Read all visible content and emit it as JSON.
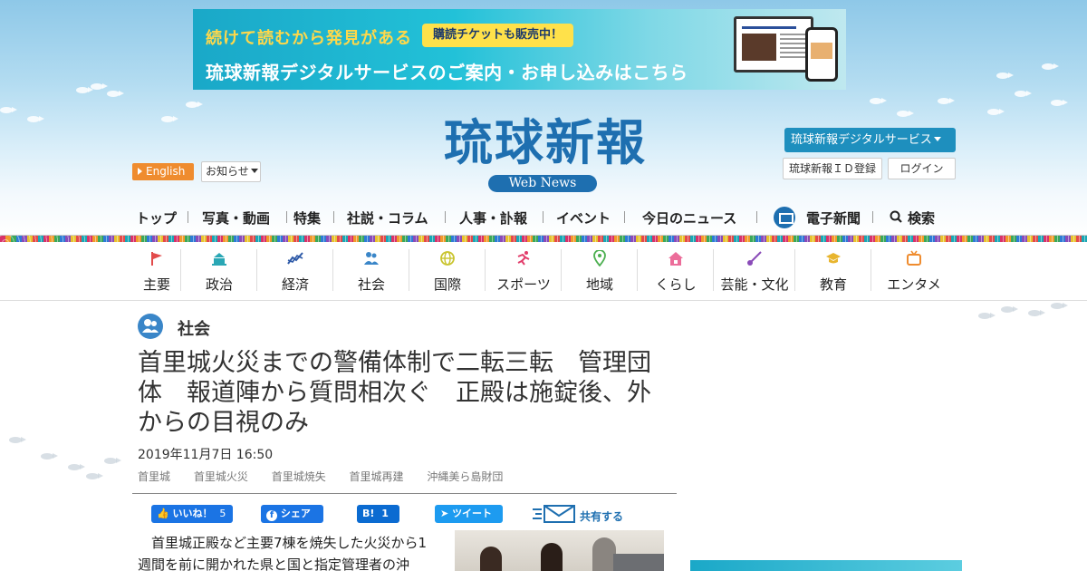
{
  "banner": {
    "line1": "続けて読むから発見がある",
    "pill": "購読チケットも販売中！",
    "line2": "琉球新報デジタルサービスのご案内・お申し込みはこちら"
  },
  "logo": {
    "title": "琉球新報",
    "subtitle": "Web News"
  },
  "header": {
    "english_label": "English",
    "notice_label": "お知らせ",
    "digital_service_label": "琉球新報デジタルサービス",
    "id_register_label": "琉球新報ＩＤ登録",
    "login_label": "ログイン"
  },
  "main_nav": {
    "items": [
      "トップ",
      "写真・動画",
      "特集",
      "社説・コラム",
      "人事・訃報",
      "イベント",
      "今日のニュース"
    ],
    "epaper_label": "電子新聞",
    "search_label": "検索"
  },
  "category_nav": {
    "items": [
      {
        "label": "主要",
        "icon": "flag-icon",
        "color": "#e24b4b"
      },
      {
        "label": "政治",
        "icon": "capitol-icon",
        "color": "#2aa7b5"
      },
      {
        "label": "経済",
        "icon": "chart-line-icon",
        "color": "#2e5aa8"
      },
      {
        "label": "社会",
        "icon": "people-icon",
        "color": "#3a86c8"
      },
      {
        "label": "国際",
        "icon": "globe-icon",
        "color": "#c9c42e"
      },
      {
        "label": "スポーツ",
        "icon": "runner-icon",
        "color": "#e23c6a"
      },
      {
        "label": "地域",
        "icon": "map-pin-icon",
        "color": "#4caf50"
      },
      {
        "label": "くらし",
        "icon": "house-icon",
        "color": "#ec6d9a"
      },
      {
        "label": "芸能・文化",
        "icon": "sanshin-icon",
        "color": "#8a4bb8"
      },
      {
        "label": "教育",
        "icon": "graduation-cap-icon",
        "color": "#e8b52e"
      },
      {
        "label": "エンタメ",
        "icon": "tv-icon",
        "color": "#ef8c2f"
      }
    ]
  },
  "article": {
    "section_label": "社会",
    "headline": "首里城火災までの警備体制で二転三転　管理団体　報道陣から質問相次ぐ　正殿は施錠後、外からの目視のみ",
    "datetime": "2019年11月7日 16:50",
    "tags": [
      "首里城",
      "首里城火災",
      "首里城焼失",
      "首里城再建",
      "沖縄美ら島財団"
    ],
    "body_excerpt": "首里城正殿など主要7棟を焼失した火災から1週間を前に開かれた県と国と指定管理者の沖"
  },
  "social": {
    "like_label": "いいね！",
    "like_count": "5",
    "share_label": "シェア",
    "hatena_label": "B!",
    "hatena_count": "1",
    "tweet_label": "ツイート",
    "share_menu_label": "共有する"
  },
  "colors": {
    "brand_blue": "#1e6fb0",
    "english_orange": "#ef8c2f",
    "facebook_blue": "#1b74e4",
    "twitter_blue": "#1d9bf0"
  }
}
